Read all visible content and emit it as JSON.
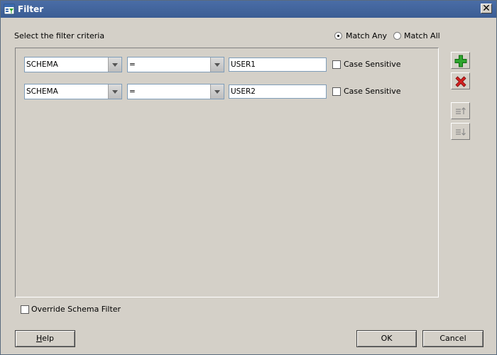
{
  "window": {
    "title": "Filter"
  },
  "criteria": {
    "prompt": "Select the filter criteria",
    "match_any_label": "Match Any",
    "match_all_label": "Match All",
    "selected_match": "Match Any"
  },
  "rows": [
    {
      "field": "SCHEMA",
      "operator": "=",
      "value": "USER1",
      "case_sensitive_label": "Case Sensitive",
      "case_sensitive": false
    },
    {
      "field": "SCHEMA",
      "operator": "=",
      "value": "USER2",
      "case_sensitive_label": "Case Sensitive",
      "case_sensitive": false
    }
  ],
  "side_buttons": {
    "add": {
      "icon": "plus-icon",
      "color": "#2ea52e",
      "enabled": true
    },
    "remove": {
      "icon": "x-icon",
      "color": "#d42020",
      "enabled": true
    },
    "move_up": {
      "icon": "move-up-icon",
      "enabled": false
    },
    "move_down": {
      "icon": "move-down-icon",
      "enabled": false
    }
  },
  "override": {
    "label": "Override Schema Filter",
    "checked": false
  },
  "buttons": {
    "help_h": "H",
    "help_rest": "elp",
    "ok": "OK",
    "cancel": "Cancel"
  }
}
